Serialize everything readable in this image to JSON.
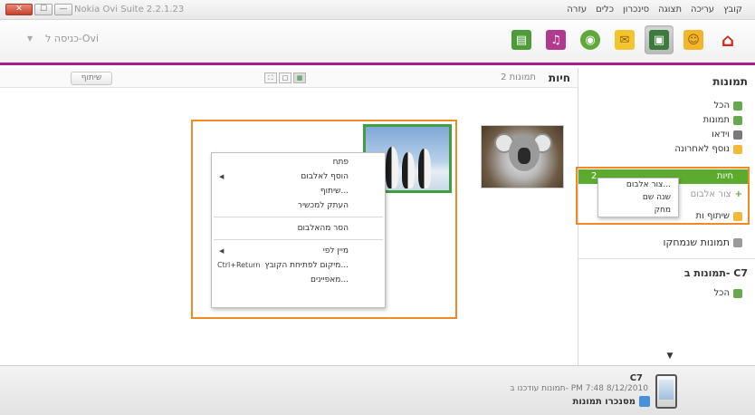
{
  "window": {
    "title": "Nokia Ovi Suite 2.2.1.23",
    "controls": [
      "—",
      "☐",
      "✕"
    ]
  },
  "menubar": [
    "קובץ",
    "עריכה",
    "תצוגה",
    "סינכרון",
    "כלים",
    "עזרה"
  ],
  "toolbar": {
    "login_label": "כניסה ל-Ovi",
    "icons": [
      "home-icon",
      "contacts-icon",
      "photos-icon",
      "messages-icon",
      "maps-icon",
      "music-icon",
      "store-icon"
    ]
  },
  "content": {
    "album_title": "חיות",
    "album_count": "2 תמונות",
    "share_label": "שיתוף"
  },
  "context_menu": {
    "items": [
      {
        "label": "פתח",
        "arrow": "",
        "shortcut": ""
      },
      {
        "label": "הוסף לאלבום",
        "arrow": "◀",
        "shortcut": ""
      },
      {
        "label": "שיתוף...",
        "arrow": "",
        "shortcut": ""
      },
      {
        "label": "העתק למכשיר",
        "arrow": "",
        "shortcut": ""
      },
      {
        "label": "הסר מהאלבום",
        "arrow": "",
        "shortcut": ""
      },
      {
        "label": "מיין לפי",
        "arrow": "◀",
        "shortcut": ""
      },
      {
        "label": "מיקום לפתיחת הקובץ...",
        "arrow": "",
        "shortcut": "Ctrl+Return"
      },
      {
        "label": "מאפיינים...",
        "arrow": "",
        "shortcut": ""
      }
    ]
  },
  "sidepanel": {
    "title": "תמונות",
    "items": [
      "הכל",
      "תמונות",
      "וידאו",
      "נוסף לאחרונה"
    ],
    "selected_album": "חיות",
    "selected_count": "2",
    "new_album": "צור אלבום",
    "shared": "שיתוף ות",
    "deleted": "תמונות שנמחקו",
    "device_title": "תמונות ב- C7",
    "device_item": "הכל"
  },
  "submenu": {
    "items": [
      "צור אלבום...",
      "שנה שם",
      "מחק"
    ]
  },
  "footer": {
    "device_name": "C7",
    "status": "תמונות עודכנו ב- PM 7:48 8/12/2010",
    "sync_label": "מסנכרו תמונות",
    "expander": "▼"
  },
  "colors": {
    "accent": "#a1208a",
    "selection": "#5cab2f",
    "highlight": "#f08a24"
  }
}
